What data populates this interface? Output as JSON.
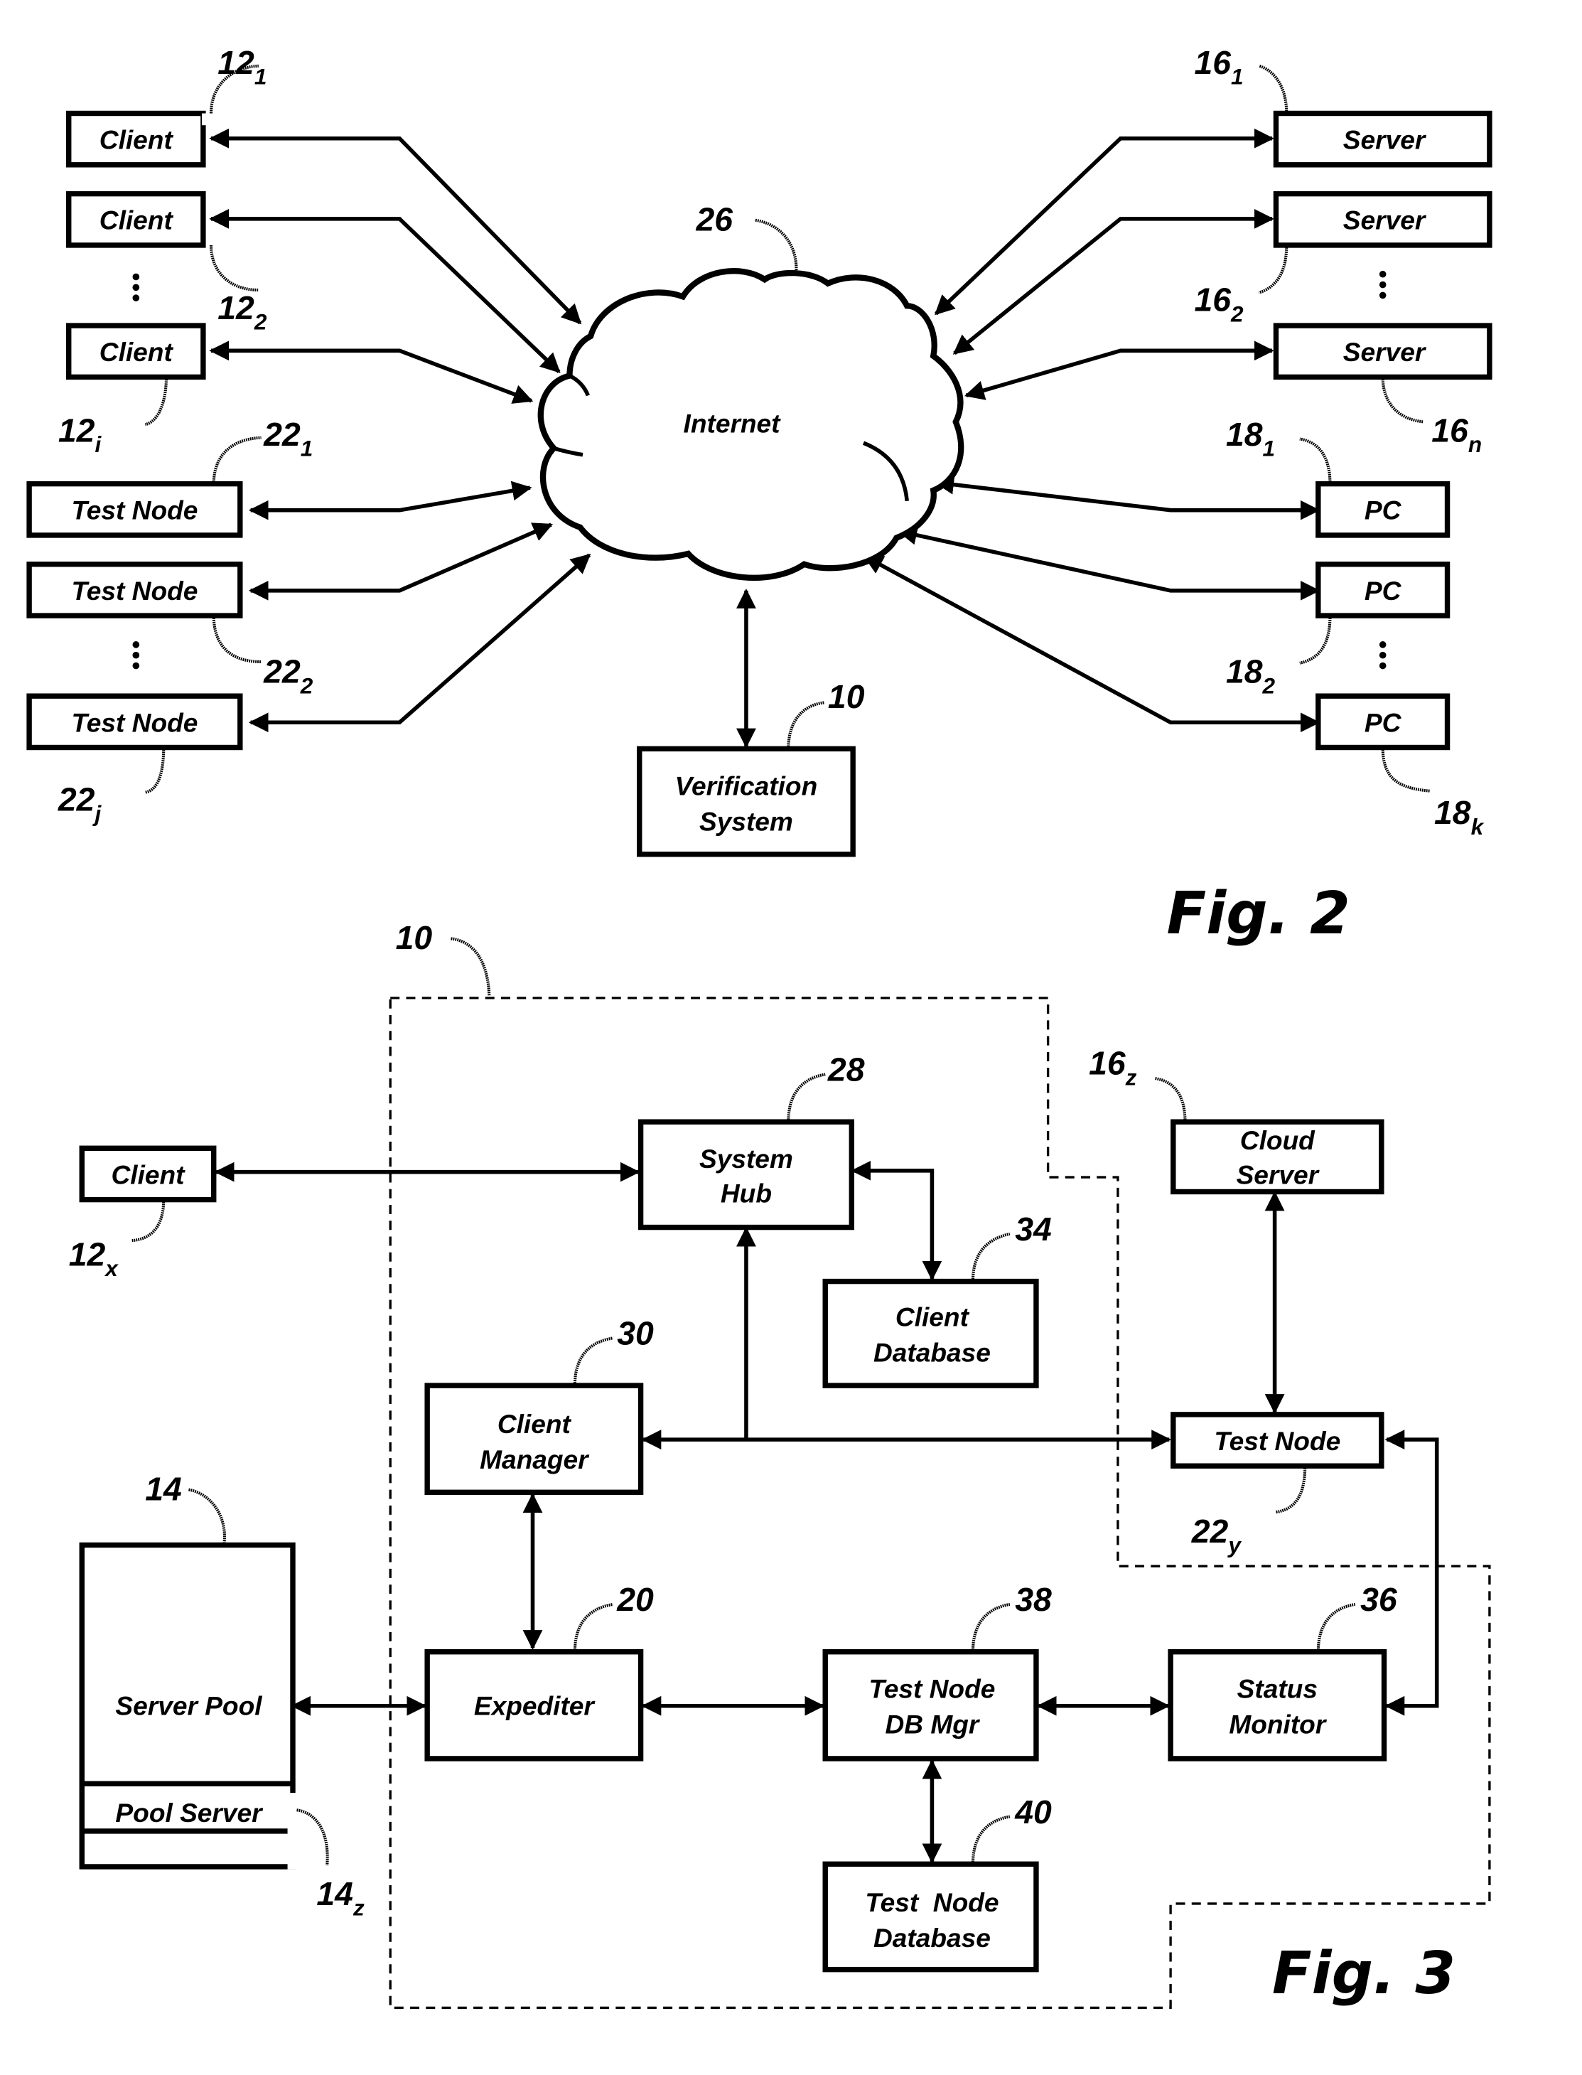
{
  "fig2": {
    "title": "Fig. 2",
    "internet": {
      "label": "Internet",
      "ref": "26"
    },
    "verification_system": {
      "line1": "Verification",
      "line2": "System",
      "ref": "10"
    },
    "clients": [
      {
        "label": "Client",
        "ref": "12",
        "sub": "1"
      },
      {
        "label": "Client",
        "ref": "12",
        "sub": "2"
      },
      {
        "label": "Client",
        "ref": "12",
        "sub": "i"
      }
    ],
    "test_nodes": [
      {
        "label": "Test Node",
        "ref": "22",
        "sub": "1"
      },
      {
        "label": "Test Node",
        "ref": "22",
        "sub": "2"
      },
      {
        "label": "Test Node",
        "ref": "22",
        "sub": "j"
      }
    ],
    "servers": [
      {
        "label": "Server",
        "ref": "16",
        "sub": "1"
      },
      {
        "label": "Server",
        "ref": "16",
        "sub": "2"
      },
      {
        "label": "Server",
        "ref": "16",
        "sub": "n"
      }
    ],
    "pcs": [
      {
        "label": "PC",
        "ref": "18",
        "sub": "1"
      },
      {
        "label": "PC",
        "ref": "18",
        "sub": "2"
      },
      {
        "label": "PC",
        "ref": "18",
        "sub": "k"
      }
    ]
  },
  "fig3": {
    "title": "Fig. 3",
    "system_ref": "10",
    "client": {
      "label": "Client",
      "ref": "12",
      "sub": "x"
    },
    "system_hub": {
      "line1": "System",
      "line2": "Hub",
      "ref": "28"
    },
    "client_database": {
      "line1": "Client",
      "line2": "Database",
      "ref": "34"
    },
    "cloud_server": {
      "line1": "Cloud",
      "line2": "Server",
      "ref": "16",
      "sub": "z"
    },
    "client_manager": {
      "line1": "Client",
      "line2": "Manager",
      "ref": "30"
    },
    "test_node": {
      "label": "Test Node",
      "ref": "22",
      "sub": "y"
    },
    "server_pool": {
      "label": "Server Pool",
      "ref": "14",
      "pool_server": "Pool Server",
      "pool_ref": "14",
      "pool_sub": "z"
    },
    "expediter": {
      "label": "Expediter",
      "ref": "20"
    },
    "test_node_db_mgr": {
      "line1": "Test Node",
      "line2": "DB Mgr",
      "ref": "38"
    },
    "status_monitor": {
      "line1": "Status",
      "line2": "Monitor",
      "ref": "36"
    },
    "test_node_database": {
      "line1": "Test  Node",
      "line2": "Database",
      "ref": "40"
    }
  }
}
